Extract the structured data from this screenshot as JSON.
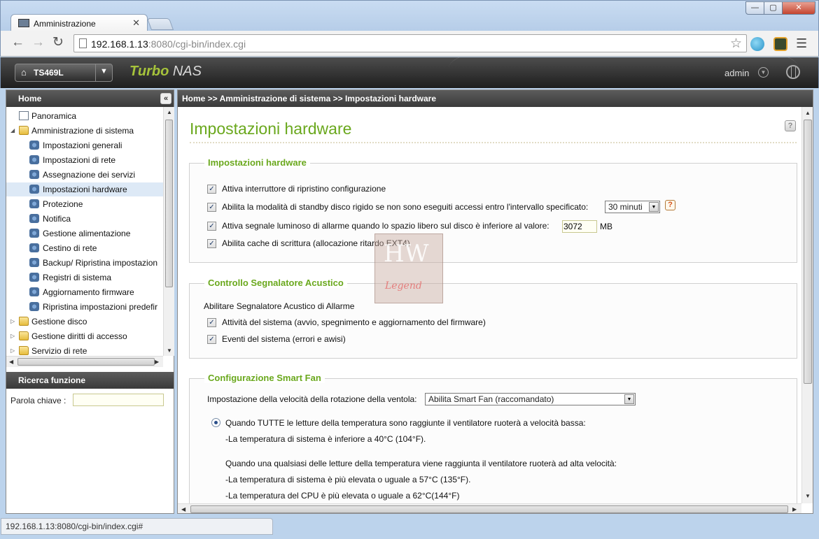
{
  "browser": {
    "tab_title": "Amministrazione",
    "tab_close": "✕",
    "url_host": "192.168.1.13",
    "url_rest": ":8080/cgi-bin/index.cgi",
    "status_url": "192.168.1.13:8080/cgi-bin/index.cgi#",
    "minimize": "—",
    "maximize": "▢",
    "close": "✕"
  },
  "header": {
    "model": "TS469L",
    "brand_turbo": "Turbo",
    "brand_nas": "NAS",
    "user": "admin"
  },
  "sidebar": {
    "title": "Home",
    "tree": [
      {
        "label": "Panoramica",
        "icon": "document-icon"
      },
      {
        "label": "Amministrazione di sistema",
        "icon": "folder-open-icon"
      },
      {
        "label": "Impostazioni generali",
        "icon": "settings-icon"
      },
      {
        "label": "Impostazioni di rete",
        "icon": "network-icon"
      },
      {
        "label": "Assegnazione dei servizi",
        "icon": "services-icon"
      },
      {
        "label": "Impostazioni hardware",
        "icon": "hardware-icon"
      },
      {
        "label": "Protezione",
        "icon": "shield-icon"
      },
      {
        "label": "Notifica",
        "icon": "notification-icon"
      },
      {
        "label": "Gestione alimentazione",
        "icon": "power-icon"
      },
      {
        "label": "Cestino di rete",
        "icon": "recycle-bin-icon"
      },
      {
        "label": "Backup/ Ripristina impostazion",
        "icon": "backup-icon"
      },
      {
        "label": "Registri di sistema",
        "icon": "log-icon"
      },
      {
        "label": "Aggiornamento firmware",
        "icon": "firmware-icon"
      },
      {
        "label": "Ripristina impostazioni predefir",
        "icon": "restore-icon"
      },
      {
        "label": "Gestione disco",
        "icon": "folder-icon"
      },
      {
        "label": "Gestione diritti di accesso",
        "icon": "folder-icon"
      },
      {
        "label": "Servizio di rete",
        "icon": "folder-icon"
      }
    ],
    "search_title": "Ricerca funzione",
    "search_label": "Parola chiave :",
    "search_value": ""
  },
  "breadcrumb": "Home >> Amministrazione di sistema >> Impostazioni hardware",
  "page": {
    "title": "Impostazioni hardware",
    "help": "?",
    "hardware": {
      "legend": "Impostazioni hardware",
      "opt_reset": "Attiva interruttore di ripristino configurazione",
      "opt_standby": "Abilita la modalità di standby disco rigido se non sono eseguiti accessi entro l'intervallo specificato:",
      "standby_value": "30 minuti",
      "opt_alarm": "Attiva segnale luminoso di allarme quando lo spazio libero sul disco è inferiore al valore:",
      "alarm_value": "3072",
      "alarm_unit": "MB",
      "opt_cache": "Abilita cache di scrittura (allocazione ritardo EXT4)"
    },
    "buzzer": {
      "legend": "Controllo Segnalatore Acustico",
      "intro": "Abilitare Segnalatore Acustico di Allarme",
      "opt_system_ops": "Attività del sistema (avvio, spegnimento e aggiornamento del firmware)",
      "opt_system_events": "Eventi del sistema (errori e awisi)"
    },
    "fan": {
      "legend": "Configurazione Smart Fan",
      "speed_label": "Impostazione della velocità della rotazione della ventola:",
      "speed_value": "Abilita Smart Fan (raccomandato)",
      "low_speed": "Quando TUTTE le letture della temperatura sono raggiunte il ventilatore ruoterà a velocità bassa:",
      "low_sys": "-La temperatura di sistema è inferiore a 40°C (104°F).",
      "high_speed": "Quando una qualsiasi delle letture della temperatura viene raggiunta il ventilatore ruoterà ad alta velocità:",
      "high_sys": "-La temperatura di sistema è più elevata o uguale a 57°C (135°F).",
      "high_cpu": "-La temperatura del CPU è più elevata o uguale a 62°C(144°F)"
    }
  },
  "watermark": {
    "line1": "HW",
    "line2": "Legend"
  },
  "colors": {
    "accent": "#6aa81d",
    "header_bg": "#3a3a3a",
    "selection": "#dde9f6"
  }
}
